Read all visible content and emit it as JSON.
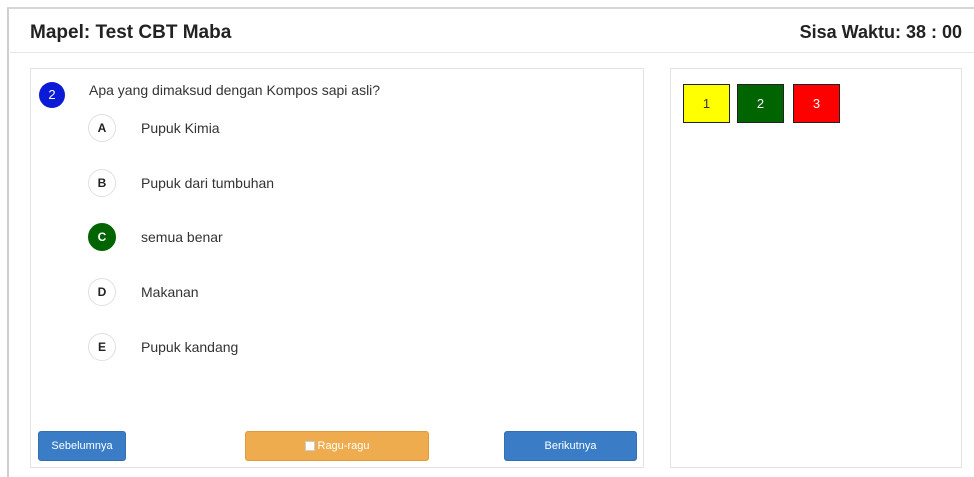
{
  "header": {
    "subject_label": "Mapel: Test CBT Maba",
    "timer_label": "Sisa Waktu: 38 : 00"
  },
  "question": {
    "number": "2",
    "text": "Apa yang dimaksud dengan Kompos sapi  asli?",
    "options": [
      {
        "letter": "A",
        "text": "Pupuk Kimia"
      },
      {
        "letter": "B",
        "text": "Pupuk dari tumbuhan"
      },
      {
        "letter": "C",
        "text": "semua benar"
      },
      {
        "letter": "D",
        "text": "Makanan"
      },
      {
        "letter": "E",
        "text": "Pupuk kandang"
      }
    ],
    "selected": "C"
  },
  "buttons": {
    "prev_label": "Sebelumnya",
    "doubt_label": "Ragu-ragu",
    "next_label": "Berikutnya"
  },
  "navigator": {
    "items": [
      {
        "label": "1",
        "color": "#ffff00",
        "text_color": "#333333"
      },
      {
        "label": "2",
        "color": "#006400",
        "text_color": "#ffffff"
      },
      {
        "label": "3",
        "color": "#ff0000",
        "text_color": "#ffffff"
      }
    ]
  },
  "colors": {
    "question_badge": "#0a1ad6",
    "selected_option": "#006400",
    "nav_button": "#3a7cc6",
    "doubt_button": "#efac4e"
  }
}
